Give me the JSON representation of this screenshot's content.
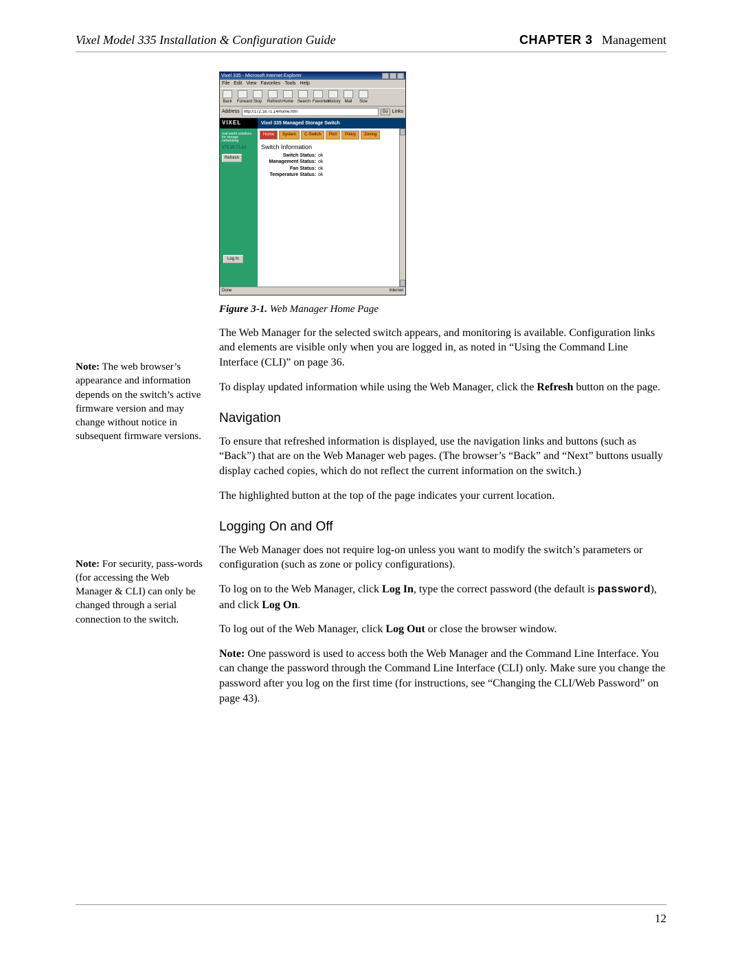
{
  "header": {
    "left": "Vixel Model 335 Installation & Configuration Guide",
    "chapter_label": "CHAPTER 3",
    "chapter_title": "Management"
  },
  "screenshot": {
    "window_title": "Vixel 335 - Microsoft Internet Explorer",
    "menu": [
      "File",
      "Edit",
      "View",
      "Favorites",
      "Tools",
      "Help"
    ],
    "toolbar": [
      "Back",
      "Forward",
      "Stop",
      "Refresh",
      "Home",
      "Search",
      "Favorites",
      "History",
      "Mail",
      "Size"
    ],
    "address_label": "Address",
    "address_value": "http://172.18.71.14/home.htm",
    "go_label": "Go",
    "links_label": "Links",
    "brand": "VIXEL",
    "slogan": "real-world solutions for storage networking",
    "top_band": "Vixel 335 Managed Storage Switch",
    "ip_text": "172.18.71.14",
    "refresh_btn": "Refresh",
    "login_btn": "Log In",
    "tabs": [
      "Home",
      "System",
      "C-Switch",
      "Port",
      "Policy",
      "Zoning"
    ],
    "panel_title": "Switch Information",
    "rows": [
      {
        "label": "Switch Status:",
        "value": "ok"
      },
      {
        "label": "Management Status:",
        "value": "ok"
      },
      {
        "label": "Fan Status:",
        "value": "ok"
      },
      {
        "label": "Temperature Status:",
        "value": "ok"
      }
    ],
    "status_left": "Done",
    "status_right": "Internet"
  },
  "figure_caption_bold": "Figure 3-1.",
  "figure_caption_rest": " Web Manager Home Page",
  "body": {
    "p1": "The Web Manager for the selected switch appears, and monitoring is available. Configuration links and elements are visible only when you are logged in, as noted in “Using the Command Line Interface (CLI)” on page 36.",
    "p2a": "To display updated information while using the Web Manager, click the ",
    "p2b": "Refresh",
    "p2c": " button on the page.",
    "h_nav": "Navigation",
    "p3": "To ensure that refreshed information is displayed, use the navigation links and buttons (such as “Back”) that are on the Web Manager web pages. (The browser’s “Back” and “Next” buttons usually display cached copies, which do not reflect the current information on the switch.)",
    "p4": "The highlighted button at the top of the page indicates your current location.",
    "h_log": "Logging On and Off",
    "p5": "The Web Manager does not require log-on unless you want to modify the switch’s parameters or configuration (such as zone or policy configurations).",
    "p6a": "To log on to the Web Manager, click ",
    "p6b": "Log In",
    "p6c": ", type the correct password (the default is ",
    "p6d": "password",
    "p6e": "), and click ",
    "p6f": "Log On",
    "p6g": ".",
    "p7a": "To log out of the Web Manager, click ",
    "p7b": "Log Out",
    "p7c": " or close the browser window.",
    "p8a": "Note:",
    "p8b": " One password is used to access both the Web Manager and the Command Line Interface. You can change the password through the Command Line Interface (CLI) only. Make sure you change the password after you log on the first time (for instructions, see “Changing the CLI/Web Password” on page 43)."
  },
  "sidenotes": {
    "n1_bold": "Note:",
    "n1_rest": " The web browser’s appearance and information depends on the switch’s active firmware version and may change without notice in subsequent firmware versions.",
    "n2_bold": "Note:",
    "n2_rest": " For security, pass-words (for accessing the Web Manager & CLI) can only be changed through a serial connection to the switch."
  },
  "page_number": "12"
}
